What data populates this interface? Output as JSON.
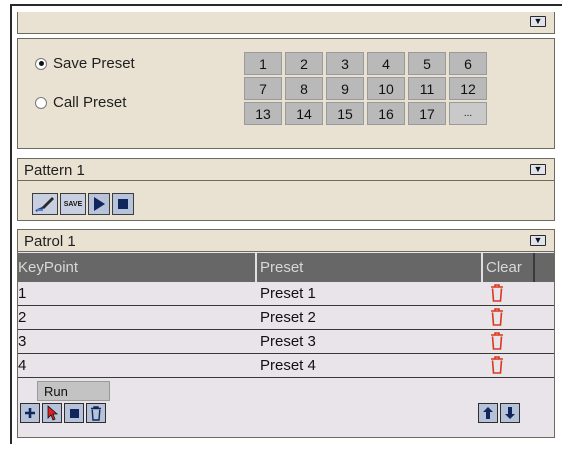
{
  "preset": {
    "save_label": "Save Preset",
    "call_label": "Call Preset",
    "selected": "save",
    "numbers": [
      "1",
      "2",
      "3",
      "4",
      "5",
      "6",
      "7",
      "8",
      "9",
      "10",
      "11",
      "12",
      "13",
      "14",
      "15",
      "16",
      "17",
      "..."
    ]
  },
  "pattern": {
    "title": "Pattern 1",
    "buttons": {
      "edit": "edit-pattern",
      "save": "SAVE",
      "play": "play",
      "stop": "stop"
    }
  },
  "patrol": {
    "title": "Patrol 1",
    "columns": [
      "KeyPoint",
      "Preset",
      "Clear"
    ],
    "rows": [
      {
        "keypoint": "1",
        "preset": "Preset 1"
      },
      {
        "keypoint": "2",
        "preset": "Preset 2"
      },
      {
        "keypoint": "3",
        "preset": "Preset 3"
      },
      {
        "keypoint": "4",
        "preset": "Preset 4"
      }
    ],
    "tooltip": "Run"
  },
  "colors": {
    "pane_bg": "#e9e2d2",
    "header_bg": "#676767",
    "trash_red": "#d83a1e",
    "button_bg": "#b7c3da"
  },
  "icons": [
    "chevron-down-icon",
    "edit-icon",
    "play-icon",
    "stop-icon",
    "trash-icon",
    "plus-icon",
    "cursor-icon",
    "arrow-up-icon",
    "arrow-down-icon"
  ]
}
